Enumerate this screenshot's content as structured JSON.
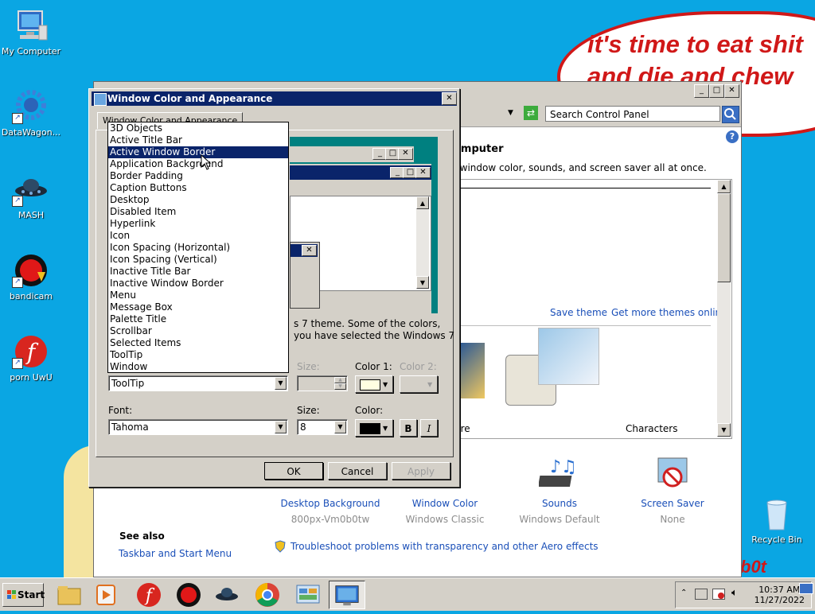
{
  "desktop": {
    "icons": [
      {
        "label": "My Computer"
      },
      {
        "label": "DataWagon..."
      },
      {
        "label": "MASH"
      },
      {
        "label": "bandicam"
      },
      {
        "label": "porn UwU"
      }
    ],
    "recycle_bin": "Recycle Bin",
    "bubble_line1": "it's time to eat shit",
    "bubble_line2": "and die and chew"
  },
  "control_panel": {
    "search_placeholder": "Search Control Panel",
    "heading_fragment": "omputer",
    "description_fragment": ", window color, sounds, and screen saver all at once.",
    "save_theme": "Save theme",
    "get_more_themes": "Get more themes online",
    "theme_note_line1": "s 7 theme.  Some of the colors,",
    "theme_note_line2": "you have selected the Windows 7",
    "theme_label_fragment": "ure",
    "theme_characters": "Characters",
    "bottom_items": [
      {
        "name": "Desktop Background",
        "sub": "800px-Vm0b0tw"
      },
      {
        "name": "Window Color",
        "sub": "Windows Classic"
      },
      {
        "name": "Sounds",
        "sub": "Windows Default"
      },
      {
        "name": "Screen Saver",
        "sub": "None"
      }
    ],
    "see_also": "See also",
    "taskbar_link": "Taskbar and Start Menu",
    "troubleshoot": "Troubleshoot problems with transparency and other Aero effects"
  },
  "dialog": {
    "title": "Window Color and Appearance",
    "tab": "Window Color and Appearance",
    "item_value": "ToolTip",
    "size_label": "Size:",
    "color1_label": "Color 1:",
    "color2_label": "Color 2:",
    "font_label": "Font:",
    "font_value": "Tahoma",
    "font_size_label": "Size:",
    "font_size_value": "8",
    "font_color_label": "Color:",
    "bold": "B",
    "italic": "I",
    "ok": "OK",
    "cancel": "Cancel",
    "apply": "Apply",
    "color1_swatch": "#ffffe1",
    "font_color_swatch": "#000000",
    "item_options": [
      "3D Objects",
      "Active Title Bar",
      "Active Window Border",
      "Application Background",
      "Border Padding",
      "Caption Buttons",
      "Desktop",
      "Disabled Item",
      "Hyperlink",
      "Icon",
      "Icon Spacing (Horizontal)",
      "Icon Spacing (Vertical)",
      "Inactive Title Bar",
      "Inactive Window Border",
      "Menu",
      "Message Box",
      "Palette Title",
      "Scrollbar",
      "Selected Items",
      "ToolTip",
      "Window"
    ],
    "highlighted_option": "Active Window Border"
  },
  "taskbar": {
    "start": "Start",
    "time": "10:37 AM",
    "date": "11/27/2022"
  }
}
